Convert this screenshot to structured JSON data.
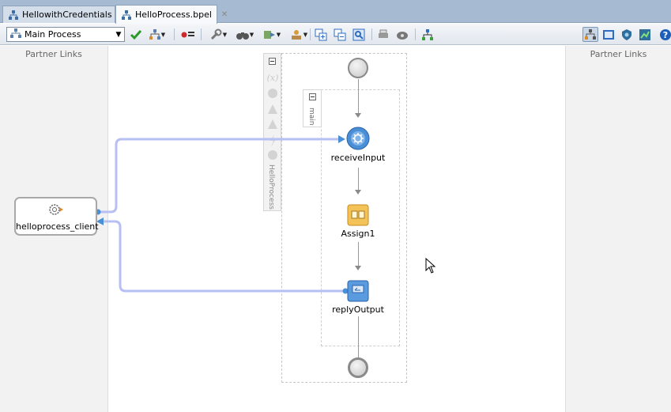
{
  "tabs": [
    {
      "label": "HellowithCredentials",
      "icon": "bpel-process-icon",
      "active": false
    },
    {
      "label": "HelloProcess.bpel",
      "icon": "bpel-process-icon",
      "active": true
    }
  ],
  "toolbar": {
    "scope_select": {
      "value": "Main Process",
      "icon": "process-tree-icon"
    },
    "buttons": [
      "validate-icon",
      "flow-icon",
      "variables-icon",
      "wrench-icon",
      "binoculars-icon",
      "deploy-icon",
      "sensors-icon",
      "expand-all-icon",
      "collapse-all-icon",
      "zoom-icon",
      "print-icon",
      "tree-icon",
      "design-view-icon",
      "source-view-icon",
      "monitor-icon",
      "chart-icon",
      "help-icon"
    ]
  },
  "lanes": {
    "left_title": "Partner Links",
    "right_title": "Partner Links"
  },
  "palette": {
    "label": "HelloProcess"
  },
  "scope": {
    "label": "main"
  },
  "activities": [
    {
      "name": "receiveInput",
      "type": "receive"
    },
    {
      "name": "Assign1",
      "type": "assign"
    },
    {
      "name": "replyOutput",
      "type": "reply"
    }
  ],
  "partner_link": {
    "label": "helloprocess_client"
  },
  "colors": {
    "link": "#b8bff2",
    "link_stroke": "#a9b1ef",
    "receive_blue": "#4a8fd6",
    "assign_yellow": "#f3c35a"
  }
}
